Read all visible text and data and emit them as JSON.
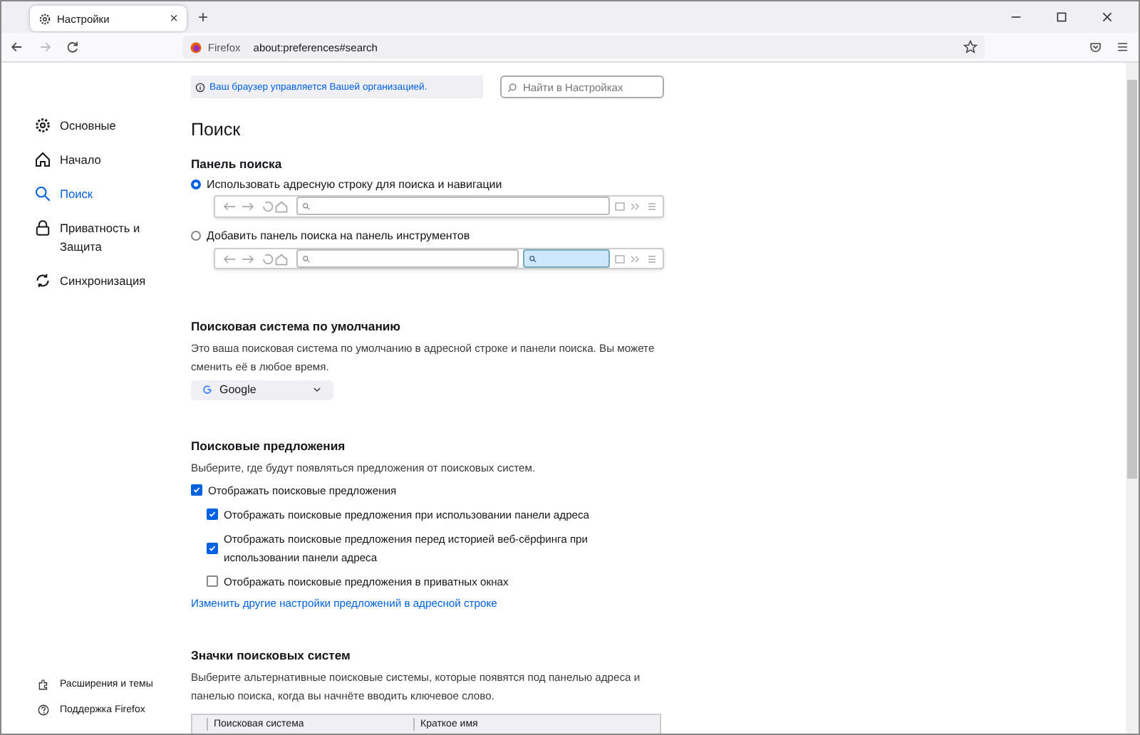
{
  "tabs": [
    {
      "title": "Настройки",
      "close": "×"
    }
  ],
  "new_tab": "+",
  "address_bar": {
    "identity": "Firefox",
    "url": "about:preferences#search"
  },
  "policy_notice": "Ваш браузер управляется Вашей организацией.",
  "search_field": {
    "placeholder": "Найти в Настройках"
  },
  "sidebar": {
    "items": [
      {
        "label": "Основные",
        "selected": false
      },
      {
        "label": "Начало",
        "selected": false
      },
      {
        "label": "Поиск",
        "selected": true
      },
      {
        "label": "Приватность и Защита",
        "selected": false
      },
      {
        "label": "Синхронизация",
        "selected": false
      }
    ],
    "footer": [
      {
        "label": "Расширения и темы"
      },
      {
        "label": "Поддержка Firefox"
      }
    ]
  },
  "page_title": "Поиск",
  "search_bar": {
    "heading": "Панель поиска",
    "options": [
      {
        "label": "Использовать адресную строку для поиска и навигации",
        "selected": true,
        "kind": "unified"
      },
      {
        "label": "Добавить панель поиска на панель инструментов",
        "selected": false,
        "kind": "separate"
      }
    ]
  },
  "default_engine": {
    "heading": "Поисковая система по умолчанию",
    "description": "Это ваша поисковая система по умолчанию в адресной строке и панели поиска. Вы можете сменить её в любое время.",
    "engine": "Google"
  },
  "suggestions": {
    "heading": "Поисковые предложения",
    "description": "Выберите, где будут появляться предложения от поисковых систем.",
    "options": [
      {
        "label": "Отображать поисковые предложения",
        "checked": true,
        "children": [
          {
            "label": "Отображать поисковые предложения при использовании панели адреса",
            "checked": true
          },
          {
            "label": "Отображать поисковые предложения перед историей веб-сёрфинга при использовании панели адреса",
            "checked": true
          },
          {
            "label": "Отображать поисковые предложения в приватных окнах",
            "checked": false
          }
        ]
      }
    ],
    "link": "Изменить другие настройки предложений в адресной строке"
  },
  "shortcuts": {
    "heading": "Значки поисковых систем",
    "description": "Выберите альтернативные поисковые системы, которые появятся под панелью адреса и панелью поиска, когда вы начнёте вводить ключевое слово.",
    "columns": [
      "Поисковая система",
      "Краткое имя"
    ]
  }
}
